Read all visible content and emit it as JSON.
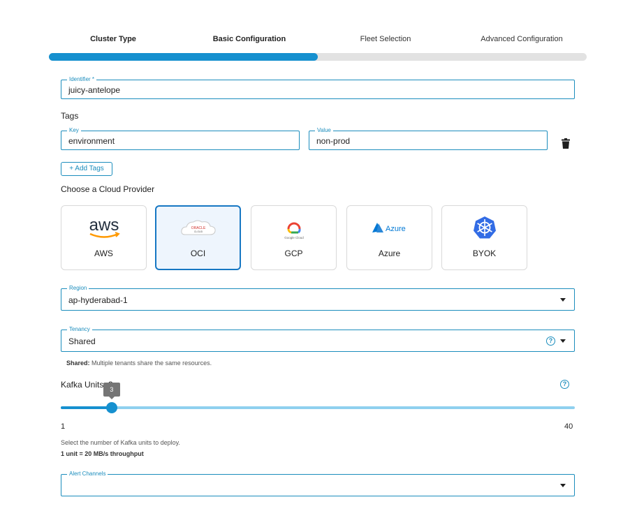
{
  "stepper": {
    "steps": [
      {
        "label": "Cluster Type"
      },
      {
        "label": "Basic Configuration"
      },
      {
        "label": "Fleet Selection"
      },
      {
        "label": "Advanced Configuration"
      }
    ],
    "progress_fraction": 0.5
  },
  "identifier": {
    "label": "Identifier *",
    "value": "juicy-antelope"
  },
  "tags": {
    "title": "Tags",
    "key_label": "Key",
    "key_value": "environment",
    "value_label": "Value",
    "value_value": "non-prod",
    "add_label": "+ Add Tags"
  },
  "cloud": {
    "title": "Choose a Cloud Provider",
    "providers": [
      {
        "name": "AWS",
        "logo_text": "aws",
        "icon": "aws-logo"
      },
      {
        "name": "OCI",
        "logo_text": "ORACLE",
        "logo_subtext": "CLOUD",
        "icon": "oracle-cloud-logo",
        "selected": true
      },
      {
        "name": "GCP",
        "logo_text": "Google Cloud",
        "icon": "google-cloud-logo"
      },
      {
        "name": "Azure",
        "logo_text": "Azure",
        "icon": "azure-logo"
      },
      {
        "name": "BYOK",
        "icon": "kubernetes-logo"
      }
    ]
  },
  "region": {
    "label": "Region",
    "value": "ap-hyderabad-1"
  },
  "tenancy": {
    "label": "Tenancy",
    "value": "Shared",
    "help_bold": "Shared:",
    "help_text": " Multiple tenants share the same resources."
  },
  "kafka": {
    "label": "Kafka Units: 3",
    "value": 3,
    "value_text": "3",
    "min": 1,
    "max": 40,
    "min_text": "1",
    "max_text": "40",
    "desc": "Select the number of Kafka units to deploy.",
    "note": "1 unit = 20 MB/s throughput"
  },
  "alert": {
    "label": "Alert Channels",
    "value": ""
  },
  "colors": {
    "accent": "#1690cf",
    "border": "#1b8dbd",
    "track": "#8fd0ef"
  }
}
